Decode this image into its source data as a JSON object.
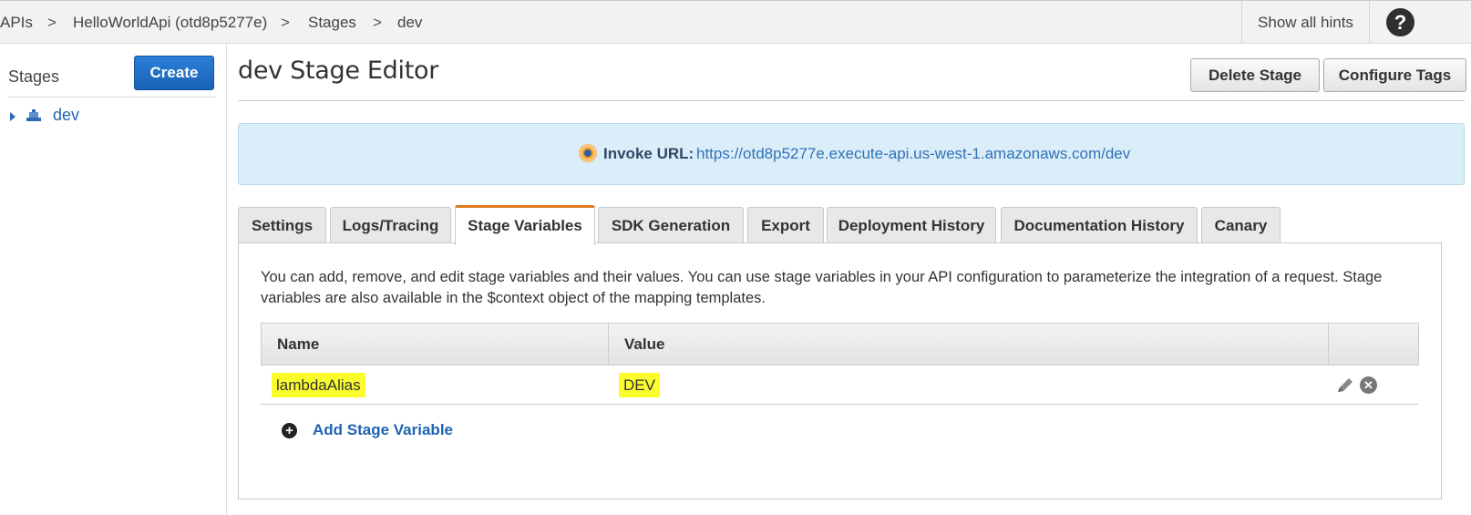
{
  "breadcrumb": {
    "items": [
      "APIs",
      "HelloWorldApi (otd8p5277e)",
      "Stages",
      "dev"
    ],
    "separator": ">"
  },
  "topbar": {
    "hints_label": "Show all hints",
    "help_glyph": "?"
  },
  "sidebar": {
    "title": "Stages",
    "create_label": "Create",
    "stages": [
      {
        "label": "dev",
        "icon": "stage-icon"
      }
    ]
  },
  "header": {
    "title": "dev Stage Editor",
    "delete_label": "Delete Stage",
    "tags_label": "Configure Tags"
  },
  "invoke": {
    "label": "Invoke URL:",
    "url": "https://otd8p5277e.execute-api.us-west-1.amazonaws.com/dev"
  },
  "tabs": [
    {
      "label": "Settings",
      "active": false
    },
    {
      "label": "Logs/Tracing",
      "active": false
    },
    {
      "label": "Stage Variables",
      "active": true
    },
    {
      "label": "SDK Generation",
      "active": false
    },
    {
      "label": "Export",
      "active": false
    },
    {
      "label": "Deployment History",
      "active": false
    },
    {
      "label": "Documentation History",
      "active": false
    },
    {
      "label": "Canary",
      "active": false
    }
  ],
  "stage_variables": {
    "description": "You can add, remove, and edit stage variables and their values. You can use stage variables in your API configuration to parameterize the integration of a request. Stage variables are also available in the $context object of the mapping templates.",
    "columns": [
      "Name",
      "Value"
    ],
    "rows": [
      {
        "name": "lambdaAlias",
        "value": "DEV"
      }
    ],
    "add_label": "Add Stage Variable"
  },
  "colors": {
    "accent": "#1f6fc5",
    "active_tab": "#e07b22",
    "highlight": "#fafc2c",
    "link": "#1f63b3"
  }
}
